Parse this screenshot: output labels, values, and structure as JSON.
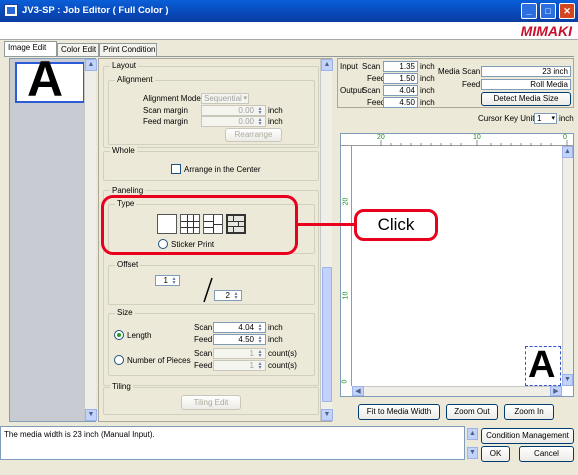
{
  "window": {
    "title": "JV3-SP : Job Editor ( Full Color )",
    "logo": "MIMAKI"
  },
  "tabs": [
    {
      "label": "Image Edit"
    },
    {
      "label": "Color Edit"
    },
    {
      "label": "Print Condition"
    }
  ],
  "thumbnail": {
    "glyph": "A"
  },
  "layout": {
    "title": "Layout",
    "alignment": {
      "title": "Alignment",
      "mode_label": "Alignment Mode",
      "mode_value": "Sequential",
      "scan_label": "Scan margin",
      "scan_value": "0.00",
      "feed_label": "Feed margin",
      "feed_value": "0.00",
      "unit": "inch",
      "rearrange": "Rearrange"
    },
    "whole": {
      "title": "Whole",
      "arrange_center": "Arrange in the Center"
    },
    "paneling": {
      "title": "Paneling"
    },
    "type": {
      "title": "Type",
      "sticker_print": "Sticker Print"
    },
    "offset": {
      "title": "Offset",
      "value1": "1",
      "value2": "2"
    },
    "size": {
      "title": "Size",
      "length": "Length",
      "number_of_pieces": "Number of Pieces",
      "scan_label": "Scan",
      "feed_label": "Feed",
      "length_scan": "4.04",
      "length_feed": "4.50",
      "pieces_scan": "1",
      "pieces_feed": "1",
      "unit_inch": "inch",
      "unit_count": "count(s)"
    },
    "tiling": {
      "title": "Tiling",
      "edit": "Tiling Edit"
    }
  },
  "info": {
    "input_label": "Input",
    "output_label": "Output",
    "scan_label": "Scan",
    "feed_label": "Feed",
    "input_scan": "1.35",
    "input_feed": "1.50",
    "output_scan": "4.04",
    "output_feed": "4.50",
    "unit": "inch",
    "media_scan_label": "Media Scan",
    "media_scan_value": "23 inch",
    "media_feed_label": "Feed",
    "media_feed_value": "Roll Media",
    "detect_button": "Detect Media Size",
    "cursor_key_label": "Cursor Key Unit",
    "cursor_key_value": "1",
    "cursor_key_unit": "inch"
  },
  "ruler": {
    "top": [
      "20",
      "10",
      "0"
    ],
    "left": [
      "20",
      "10",
      "0"
    ]
  },
  "preview": {
    "glyph": "A"
  },
  "zoom": {
    "fit": "Fit to Media Width",
    "out": "Zoom Out",
    "in": "Zoom In"
  },
  "status": {
    "message": "The media width is 23 inch (Manual Input)."
  },
  "actions": {
    "condition_management": "Condition Management",
    "ok": "OK",
    "cancel": "Cancel"
  },
  "annotation": {
    "click_label": "Click"
  },
  "colors": {
    "callout": "#e8001c",
    "titlebar": "#0a5fd8",
    "logo": "#c8102e"
  }
}
